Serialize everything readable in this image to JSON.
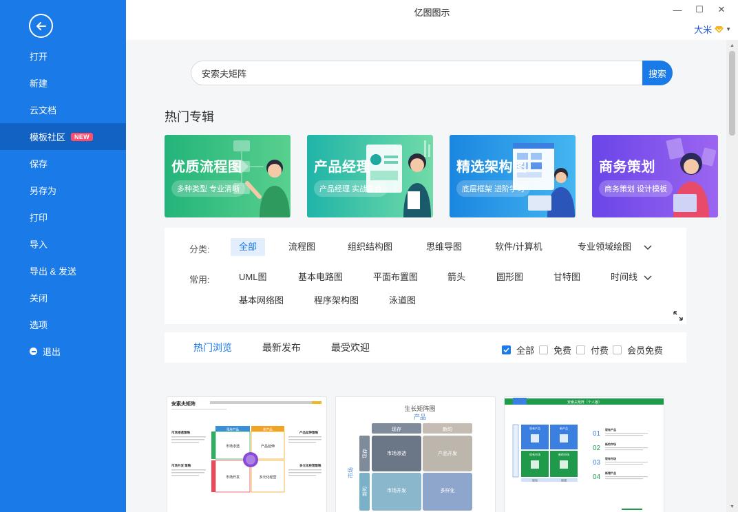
{
  "window": {
    "title": "亿图图示",
    "minimize": "—",
    "maximize": "☐",
    "close": "✕"
  },
  "user": {
    "name": "大米",
    "icon": "vip-diamond-icon"
  },
  "sidebar": {
    "items": [
      {
        "label": "打开"
      },
      {
        "label": "新建"
      },
      {
        "label": "云文档"
      },
      {
        "label": "模板社区",
        "badge": "NEW",
        "active": true
      },
      {
        "label": "保存"
      },
      {
        "label": "另存为"
      },
      {
        "label": "打印"
      },
      {
        "label": "导入"
      },
      {
        "label": "导出 & 发送"
      },
      {
        "label": "关闭"
      },
      {
        "label": "选项"
      },
      {
        "label": "退出"
      }
    ]
  },
  "search": {
    "value": "安索夫矩阵",
    "button": "搜索"
  },
  "hot": {
    "title": "热门专辑",
    "banners": [
      {
        "title": "优质流程图",
        "subtitle": "多种类型 专业清晰",
        "color_from": "#23b47a",
        "color_to": "#59d08e"
      },
      {
        "title": "产品经理",
        "subtitle": "产品经理 实战集合",
        "color_from": "#1fb4a8",
        "color_to": "#72dba8"
      },
      {
        "title": "精选架构图",
        "subtitle": "底层框架 进阶学习",
        "color_from": "#1a86e0",
        "color_to": "#45b6f0"
      },
      {
        "title": "商务策划",
        "subtitle": "商务策划 设计模板",
        "color_from": "#6a45e8",
        "color_to": "#9b65f0"
      }
    ]
  },
  "filters": {
    "category_label": "分类:",
    "categories": [
      "全部",
      "流程图",
      "组织结构图",
      "思维导图",
      "软件/计算机",
      "专业领域绘图"
    ],
    "common_label": "常用:",
    "common": [
      "UML图",
      "基本电路图",
      "平面布置图",
      "箭头",
      "圆形图",
      "甘特图",
      "时间线",
      "基本网络图",
      "程序架构图",
      "泳道图"
    ]
  },
  "tabs": {
    "items": [
      "热门浏览",
      "最新发布",
      "最受欢迎"
    ],
    "active": 0,
    "checkboxes": [
      {
        "label": "全部",
        "checked": true
      },
      {
        "label": "免费",
        "checked": false
      },
      {
        "label": "付费",
        "checked": false
      },
      {
        "label": "会员免费",
        "checked": false
      }
    ]
  },
  "templates": [
    {
      "title": "安索夫矩阵",
      "quadrants": [
        "市场渗透",
        "产品延伸",
        "市场开发",
        "多元化经营"
      ],
      "headers": [
        "现有产品",
        "新产品"
      ],
      "left_notes": [
        "市场渗透策略",
        "市场开发 策略"
      ],
      "right_notes": [
        "产品延伸策略",
        "多元化经营策略"
      ]
    },
    {
      "title": "生长矩阵图",
      "subtitle": "产品",
      "col_headers": [
        "现存",
        "新的"
      ],
      "side_label": "市场",
      "row_headers": [
        "现存",
        "新的"
      ],
      "cells": [
        "市场渗透",
        "产品开发",
        "市场开发",
        "多样化"
      ]
    },
    {
      "title": "安索夫矩阵（个人版）",
      "cells": [
        "现有产品",
        "新产品",
        "现有市场",
        "新的市场"
      ],
      "bottom_labels": [
        "现有",
        "新增"
      ],
      "list": [
        {
          "num": "01",
          "title": "现有产品"
        },
        {
          "num": "02",
          "title": "新的市场"
        },
        {
          "num": "03",
          "title": "现有市场"
        },
        {
          "num": "04",
          "title": "新增产品"
        }
      ]
    }
  ]
}
